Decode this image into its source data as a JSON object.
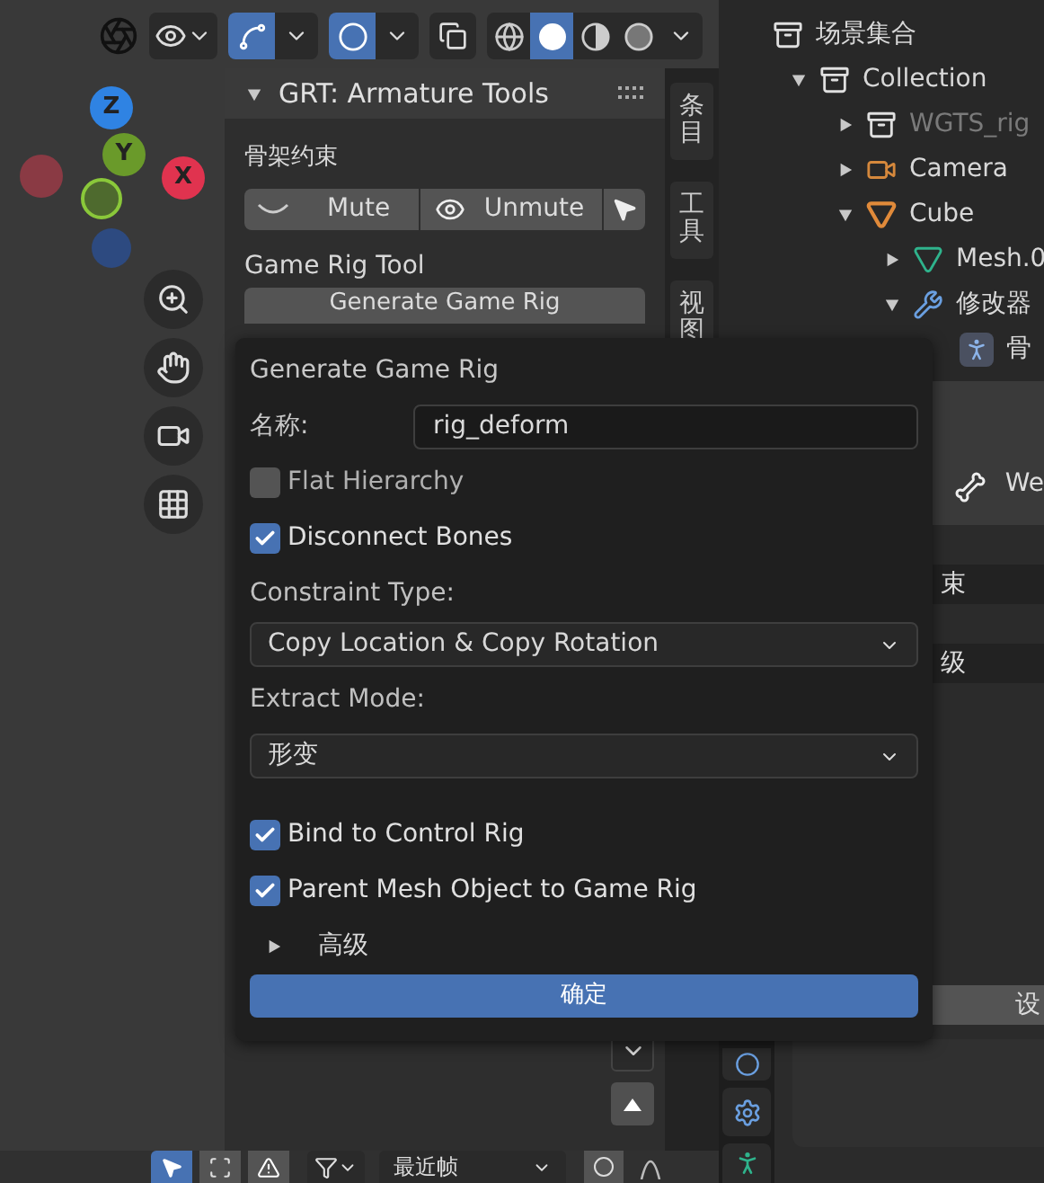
{
  "viewport_header": {
    "gizmos_on": true,
    "overlays_on": true,
    "shading": [
      {
        "kind": "wireframe",
        "selected": false
      },
      {
        "kind": "solid",
        "selected": true
      },
      {
        "kind": "material",
        "selected": false
      },
      {
        "kind": "rendered",
        "selected": false
      }
    ]
  },
  "gizmo": {
    "axes": [
      {
        "label": "Z",
        "kind": "z"
      },
      {
        "label": "Y",
        "kind": "y"
      },
      {
        "label": "X",
        "kind": "x"
      }
    ]
  },
  "n_panel": {
    "title": "GRT: Armature Tools",
    "expanded": true,
    "section_label": "骨架约束",
    "mute_button": "Mute",
    "unmute_button": "Unmute",
    "tool_label": "Game Rig Tool",
    "generate_button": "Generate Game Rig"
  },
  "side_tabs": [
    {
      "label": "条目"
    },
    {
      "label": "工具"
    },
    {
      "label": "视图"
    }
  ],
  "outliner": {
    "items": [
      {
        "label": "场景集合",
        "kind": "collection",
        "children": [
          {
            "label": "Collection",
            "kind": "collection",
            "expanded": true,
            "children": [
              {
                "label": "WGTS_rig",
                "kind": "collection",
                "expanded": false,
                "disabled": true
              },
              {
                "label": "Camera",
                "kind": "camera",
                "expanded": false,
                "disabled": false
              },
              {
                "label": "Cube",
                "kind": "mesh",
                "expanded": true,
                "disabled": false,
                "children": [
                  {
                    "label": "Mesh.0",
                    "kind": "data",
                    "expanded": false,
                    "disabled": false
                  },
                  {
                    "label": "修改器",
                    "kind": "modifier",
                    "expanded": true,
                    "disabled": false,
                    "children": [
                      {
                        "label": "骨",
                        "kind": "armature"
                      }
                    ]
                  }
                ]
              }
            ]
          }
        ]
      }
    ]
  },
  "properties": {
    "bone_field": "We",
    "constraint_field": "束",
    "parent_field": "级",
    "button": "设"
  },
  "dialog": {
    "title": "Generate Game Rig",
    "name_label": "名称:",
    "name_value": "rig_deform",
    "options": [
      {
        "label": "Flat Hierarchy",
        "checked": false
      },
      {
        "label": "Disconnect Bones",
        "checked": true
      }
    ],
    "constraint_label": "Constraint Type:",
    "constraint_value": "Copy Location & Copy Rotation",
    "extract_label": "Extract Mode:",
    "extract_value": "形变",
    "options2": [
      {
        "label": "Bind to Control Rig",
        "checked": true
      },
      {
        "label": "Parent Mesh Object to Game Rig",
        "checked": true
      }
    ],
    "advanced": {
      "label": "高级",
      "expanded": false
    },
    "ok_button": "确定"
  },
  "timeline_header": {
    "frame_dropdown": "最近帧"
  }
}
